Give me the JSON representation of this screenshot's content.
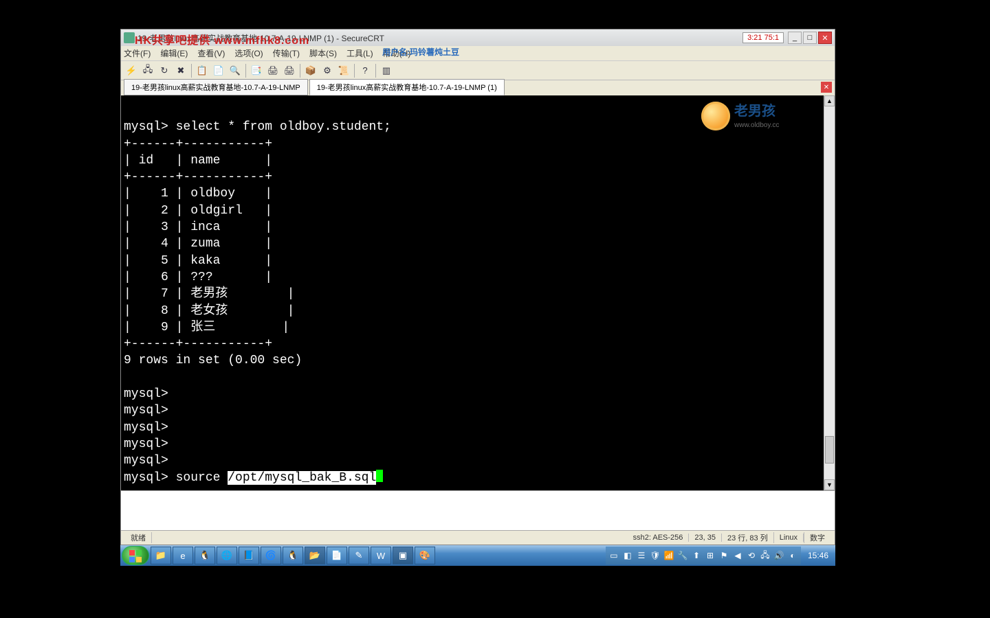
{
  "window": {
    "title": "19-老男孩linux高薪实战教育基地-10.7-A-19-LNMP (1) - SecureCRT"
  },
  "watermark": "HK共享吧提供 www.mfhk8.com",
  "recbadge": "3:21 75:1",
  "menubar": {
    "file": "文件(F)",
    "edit": "编辑(E)",
    "view": "查看(V)",
    "options": "选项(O)",
    "transfer": "传输(T)",
    "script": "脚本(S)",
    "tools": "工具(L)",
    "help": "帮助(H)"
  },
  "menubar_overlay": "用户名:玛铃薯炖土豆",
  "tabs": {
    "tab1": "19-老男孩linux高薪实战教育基地-10.7-A-19-LNMP",
    "tab2": "19-老男孩linux高薪实战教育基地-10.7-A-19-LNMP (1)"
  },
  "terminal": {
    "line1": "mysql> select * from oldboy.student;",
    "sep": "+------+-----------+",
    "hdr": "| id   | name      |",
    "rows": [
      "|    1 | oldboy    |",
      "|    2 | oldgirl   |",
      "|    3 | inca      |",
      "|    4 | zuma      |",
      "|    5 | kaka      |",
      "|    6 | ???       |",
      "|    7 | 老男孩        |",
      "|    8 | 老女孩        |",
      "|    9 | 张三         |"
    ],
    "summary": "9 rows in set (0.00 sec)",
    "prompt": "mysql> ",
    "source_cmd": "source ",
    "source_path": "/opt/mysql_bak_B.sql"
  },
  "logo": {
    "cn": "老男孩",
    "url": "www.oldboy.cc"
  },
  "statusbar": {
    "ready": "就绪",
    "conn": "ssh2: AES-256",
    "pos": "23, 35",
    "dim": "23 行, 83 列",
    "platform": "Linux",
    "numlock": "数字"
  },
  "taskbar": {
    "clock": "15:46"
  }
}
